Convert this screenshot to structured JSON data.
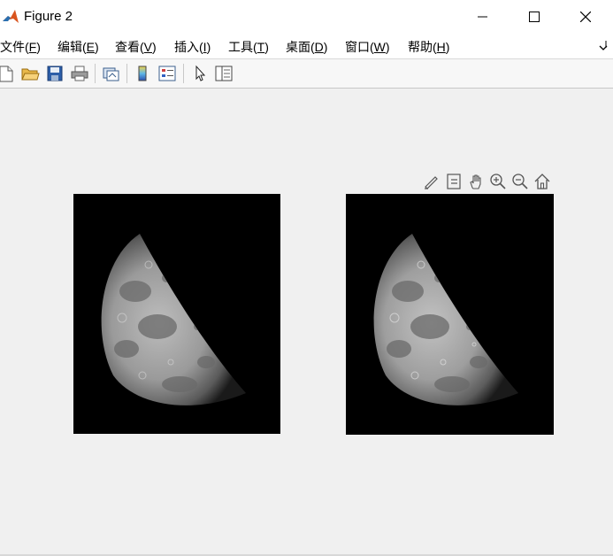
{
  "window": {
    "title": "Figure 2",
    "controls": [
      "minimize",
      "maximize",
      "close"
    ]
  },
  "menu": {
    "items": [
      {
        "text": "文件(",
        "accel": "F",
        "close": ")"
      },
      {
        "text": "编辑(",
        "accel": "E",
        "close": ")"
      },
      {
        "text": "查看(",
        "accel": "V",
        "close": ")"
      },
      {
        "text": "插入(",
        "accel": "I",
        "close": ")"
      },
      {
        "text": "工具(",
        "accel": "T",
        "close": ")"
      },
      {
        "text": "桌面(",
        "accel": "D",
        "close": ")"
      },
      {
        "text": "窗口(",
        "accel": "W",
        "close": ")"
      },
      {
        "text": "帮助(",
        "accel": "H",
        "close": ")"
      }
    ]
  },
  "toolbar": {
    "icons": [
      "new-figure-icon",
      "open-file-icon",
      "save-icon",
      "print-icon",
      "link-figure-icon",
      "colorbar-icon",
      "legend-icon",
      "select-arrow-icon",
      "property-inspector-icon"
    ]
  },
  "axes_toolbar": {
    "icons": [
      "brush-icon",
      "data-tips-icon",
      "pan-hand-icon",
      "zoom-in-icon",
      "zoom-out-icon",
      "home-icon"
    ]
  },
  "images": [
    {
      "name": "moon-image-left"
    },
    {
      "name": "moon-image-right"
    }
  ]
}
